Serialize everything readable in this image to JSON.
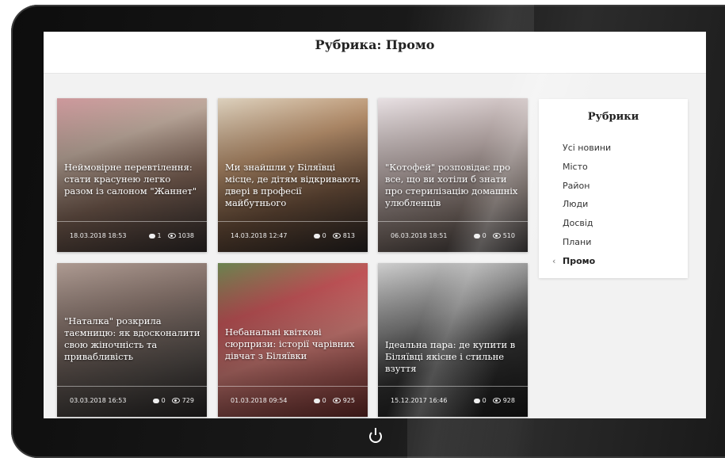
{
  "page": {
    "title": "Рубрика: Промо"
  },
  "colors": {
    "device_bezel": "#111111",
    "screen_bg": "#f2f2f2",
    "topbar_bg": "#ffffff",
    "card_text": "#ffffff",
    "sidebar_bg": "#ffffff"
  },
  "cards": [
    {
      "title": "Неймовірне перевтілення: стати красунею легко разом із салоном \"Жаннет\"",
      "date": "18.03.2018 18:53",
      "comments": "1",
      "views": "1038",
      "image": "salon-photo",
      "bg": "linear-gradient(160deg,#d8a0a4 0%,#c9b4a6 30%,#8a6d5e 60%,#3b3433 100%)"
    },
    {
      "title": "Ми знайшли у Біляївці місце, де дітям відкривають двері в професії майбутнього",
      "date": "14.03.2018 12:47",
      "comments": "0",
      "views": "813",
      "image": "kids-robotics-photo",
      "bg": "linear-gradient(160deg,#e8dcc8 0%,#c49a74 35%,#7b5b44 65%,#2f2a29 100%)"
    },
    {
      "title": "\"Котофей\" розповідає про все, що ви хотіли б знати про стерилізацію домашніх улюбленців",
      "date": "06.03.2018 18:51",
      "comments": "0",
      "views": "510",
      "image": "clinic-door-photo",
      "bg": "linear-gradient(160deg,#f4ecef 0%,#c9b9b7 40%,#8f7f78 70%,#3a3636 100%)"
    },
    {
      "title": "\"Наталка\" розкрила таємницю: як вдосконалити свою жіночність та привабливість",
      "date": "03.03.2018 16:53",
      "comments": "0",
      "views": "729",
      "image": "dress-photo",
      "bg": "linear-gradient(160deg,#b7a39a 0%,#8e7a72 35%,#5d5652 70%,#2e2c2c 100%)"
    },
    {
      "title": "Небанальні квіткові сюрпризи: історії чарівних дівчат з Біляївки",
      "date": "01.03.2018 09:54",
      "comments": "0",
      "views": "925",
      "image": "roses-photo",
      "bg": "linear-gradient(160deg,#6f8a53 0%,#d05a5e 30%,#e88b85 55%,#7d3330 100%)"
    },
    {
      "title": "Ідеальна пара: де купити в Біляївці якісне і стильне взуття",
      "date": "15.12.2017 16:46",
      "comments": "0",
      "views": "928",
      "image": "boots-photo",
      "bg": "linear-gradient(160deg,#d9d9d9 0%,#8c8c8c 35%,#3a3a3a 60%,#1d1d1d 100%)"
    }
  ],
  "sidebar": {
    "title": "Рубрики",
    "items": [
      {
        "label": "Усі новини",
        "active": false
      },
      {
        "label": "Місто",
        "active": false
      },
      {
        "label": "Район",
        "active": false
      },
      {
        "label": "Люди",
        "active": false
      },
      {
        "label": "Досвід",
        "active": false
      },
      {
        "label": "Плани",
        "active": false
      },
      {
        "label": "Промо",
        "active": true
      }
    ],
    "active_marker": "‹"
  },
  "device": {
    "power_icon": "power-icon"
  }
}
